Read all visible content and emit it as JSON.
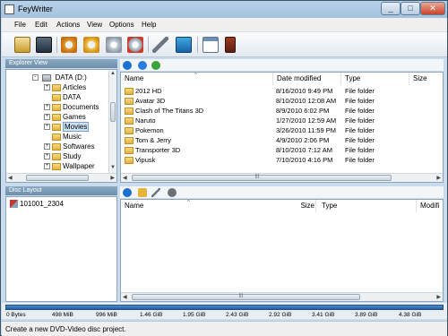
{
  "window": {
    "title": "FeyWriter",
    "min_glyph": "_",
    "max_glyph": "□",
    "close_glyph": "✕"
  },
  "menu": [
    "File",
    "Edit",
    "Actions",
    "View",
    "Options",
    "Help"
  ],
  "explorer": {
    "header": "Explorer View",
    "drive": "DATA (D:)",
    "folders": [
      "Articles",
      "DATA",
      "Documents",
      "Games",
      "Movies",
      "Music",
      "Softwares",
      "Study",
      "Wallpaper"
    ],
    "selected": "Movies"
  },
  "files": {
    "columns": [
      "Name",
      "Date modified",
      "Type",
      "Size"
    ],
    "rows": [
      {
        "name": "2012 HD",
        "date": "8/16/2010 9:49 PM",
        "type": "File folder"
      },
      {
        "name": "Avatar 3D",
        "date": "8/10/2010 12:08 AM",
        "type": "File folder"
      },
      {
        "name": "Clash of The Titans 3D",
        "date": "8/9/2010 6:02 PM",
        "type": "File folder"
      },
      {
        "name": "Naruto",
        "date": "1/27/2010 12:59 AM",
        "type": "File folder"
      },
      {
        "name": "Pokemon",
        "date": "3/26/2010 11:59 PM",
        "type": "File folder"
      },
      {
        "name": "Tom & Jerry",
        "date": "4/9/2010 2:06 PM",
        "type": "File folder"
      },
      {
        "name": "Transporter 3D",
        "date": "8/10/2010 7:12 AM",
        "type": "File folder"
      },
      {
        "name": "Vipusk",
        "date": "7/10/2010 4:16 PM",
        "type": "File folder"
      }
    ]
  },
  "disc": {
    "header": "Disc Layout",
    "project": "101001_2304",
    "columns": [
      "Name",
      "Size",
      "Type",
      "Modifi"
    ]
  },
  "capacity": [
    "0 Bytes",
    "498 MiB",
    "996 MiB",
    "1.46 GiB",
    "1.95 GiB",
    "2.43 GiB",
    "2.92 GiB",
    "3.41 GiB",
    "3.89 GiB",
    "4.38 GiB"
  ],
  "status": "Create a new DVD-Video disc project.",
  "scroll_glyphs": {
    "left": "◀",
    "right": "▶",
    "up": "▲",
    "down": "▼",
    "grip": "|||",
    "sort": "^"
  }
}
